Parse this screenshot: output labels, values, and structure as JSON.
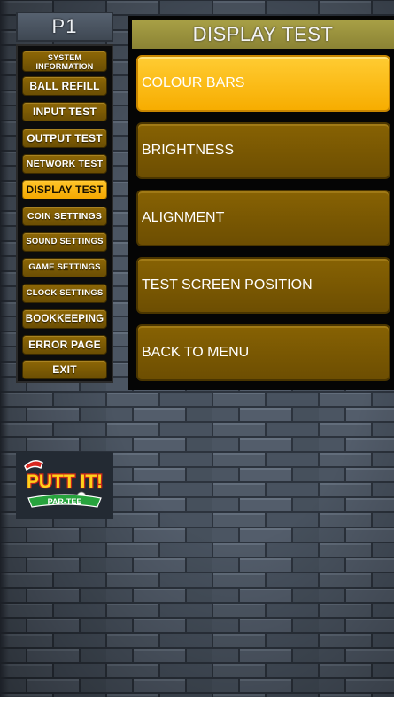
{
  "header": {
    "player_label": "P1"
  },
  "sidebar": {
    "items": [
      {
        "label": "SYSTEM\nINFORMATION",
        "active": false
      },
      {
        "label": "BALL REFILL",
        "active": false
      },
      {
        "label": "INPUT TEST",
        "active": false
      },
      {
        "label": "OUTPUT TEST",
        "active": false
      },
      {
        "label": "NETWORK TEST",
        "active": false
      },
      {
        "label": "DISPLAY TEST",
        "active": true
      },
      {
        "label": "COIN SETTINGS",
        "active": false
      },
      {
        "label": "SOUND SETTINGS",
        "active": false
      },
      {
        "label": "GAME SETTINGS",
        "active": false
      },
      {
        "label": "CLOCK SETTINGS",
        "active": false
      },
      {
        "label": "BOOKKEEPING",
        "active": false
      },
      {
        "label": "ERROR PAGE",
        "active": false
      },
      {
        "label": "EXIT",
        "active": false
      }
    ]
  },
  "main": {
    "title": "DISPLAY TEST",
    "options": [
      {
        "label": "COLOUR BARS",
        "active": true
      },
      {
        "label": "BRIGHTNESS",
        "active": false
      },
      {
        "label": "ALIGNMENT",
        "active": false
      },
      {
        "label": "TEST SCREEN POSITION",
        "active": false
      },
      {
        "label": "BACK TO MENU",
        "active": false
      }
    ]
  },
  "logo": {
    "text_top": "PUTT IT!",
    "text_bottom": "PAR-TEE"
  },
  "colors": {
    "active_button": "#f7ad00",
    "inactive_button": "#7a5903",
    "title_bar": "#9a9240",
    "panel_background": "#050505",
    "wall": "#434d5a"
  }
}
